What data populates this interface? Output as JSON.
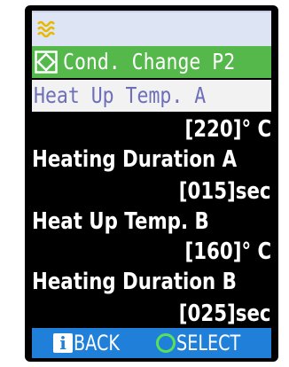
{
  "title_bar": {
    "icon": "heater-coil-icon"
  },
  "header": {
    "icon": "diamond-circle-icon",
    "title": "Cond. Change P2"
  },
  "selected_item": {
    "label": "Heat Up Temp. A"
  },
  "rows": [
    {
      "value": "[220]° C"
    },
    {
      "label": "Heating Duration A"
    },
    {
      "value": "[015]sec"
    },
    {
      "label": "Heat Up Temp. B"
    },
    {
      "value": "[160]° C"
    },
    {
      "label": "Heating Duration B"
    },
    {
      "value": "[025]sec"
    }
  ],
  "footer": {
    "back_icon": "info-icon",
    "back_label": "BACK",
    "select_icon": "circle-icon",
    "select_label": "SELECT"
  },
  "colors": {
    "screen_bg": "#000000",
    "title_bar_bg": "#dde4f4",
    "header_bg": "#54b84a",
    "selected_bg": "#f2f2f2",
    "selected_text": "#6e6fb8",
    "footer_bg": "#1f7fd9",
    "select_icon": "#58e058"
  }
}
